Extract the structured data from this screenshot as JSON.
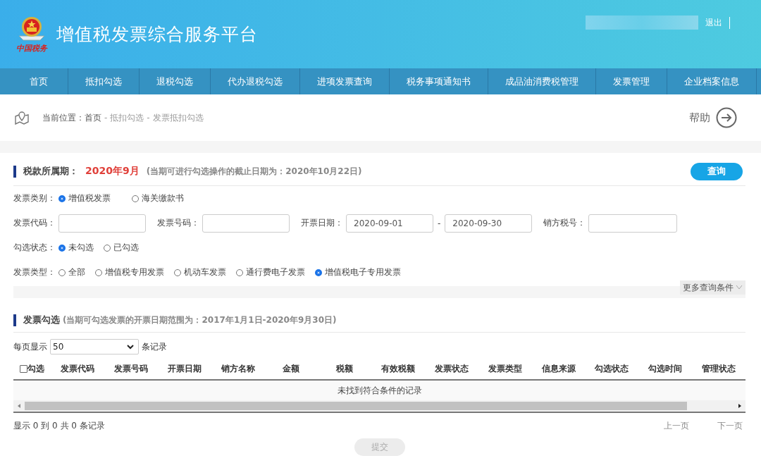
{
  "header": {
    "logo_text": "中国税务",
    "title": "增值税发票综合服务平台",
    "logout": "退出"
  },
  "nav": [
    {
      "label": "首页",
      "selected": false
    },
    {
      "label": "抵扣勾选",
      "selected": false
    },
    {
      "label": "退税勾选",
      "selected": false
    },
    {
      "label": "代办退税勾选",
      "selected": false
    },
    {
      "label": "进项发票查询",
      "selected": false
    },
    {
      "label": "税务事项通知书",
      "selected": false
    },
    {
      "label": "成品油消费税管理",
      "selected": false
    },
    {
      "label": "发票管理",
      "selected": false
    },
    {
      "label": "企业档案信息",
      "selected": false
    }
  ],
  "breadcrumb": {
    "label": "当前位置：",
    "items": [
      "首页",
      "抵扣勾选",
      "发票抵扣勾选"
    ],
    "separator": "-",
    "help": "帮助"
  },
  "period": {
    "title": "税款所属期：",
    "value": "2020年9月",
    "note": "(当期可进行勾选操作的截止日期为：2020年10月22日)",
    "query_button": "查询"
  },
  "filters": {
    "invoice_category": {
      "label": "发票类别：",
      "options": [
        {
          "label": "增值税发票",
          "selected": true
        },
        {
          "label": "海关缴款书",
          "selected": false
        }
      ]
    },
    "fields": [
      {
        "label": "发票代码：",
        "kind": "text"
      },
      {
        "label": "发票号码：",
        "kind": "text"
      },
      {
        "label": "开票日期：",
        "kind": "date_range",
        "from": "2020-09-01",
        "separator": "-",
        "to": "2020-09-30"
      },
      {
        "label": "销方税号：",
        "kind": "text"
      }
    ],
    "check_status": {
      "label": "勾选状态：",
      "options": [
        {
          "label": "未勾选",
          "selected": true
        },
        {
          "label": "已勾选",
          "selected": false
        }
      ]
    },
    "invoice_type": {
      "label": "发票类型：",
      "options": [
        {
          "label": "全部",
          "selected": false
        },
        {
          "label": "增值税专用发票",
          "selected": false
        },
        {
          "label": "机动车发票",
          "selected": false
        },
        {
          "label": "通行费电子发票",
          "selected": false
        },
        {
          "label": "增值税电子专用发票",
          "selected": true
        }
      ]
    },
    "more": "更多查询条件"
  },
  "selection": {
    "title": "发票勾选",
    "note": "(当期可勾选发票的开票日期范围为：2017年1月1日-2020年9月30日)",
    "page_size_label": "每页显示",
    "page_size": "50",
    "page_size_suffix": "条记录",
    "select_all": {
      "label": "勾选",
      "checked": false
    },
    "columns": [
      "发票代码",
      "发票号码",
      "开票日期",
      "销方名称",
      "金额",
      "税额",
      "有效税额",
      "发票状态",
      "发票类型",
      "信息来源",
      "勾选状态",
      "勾选时间",
      "管理状态"
    ],
    "empty": "未找到符合条件的记录",
    "summary": "显示 0 到 0 共 0 条记录",
    "prev": "上一页",
    "next": "下一页",
    "submit": {
      "label": "提交",
      "disabled": true
    }
  }
}
